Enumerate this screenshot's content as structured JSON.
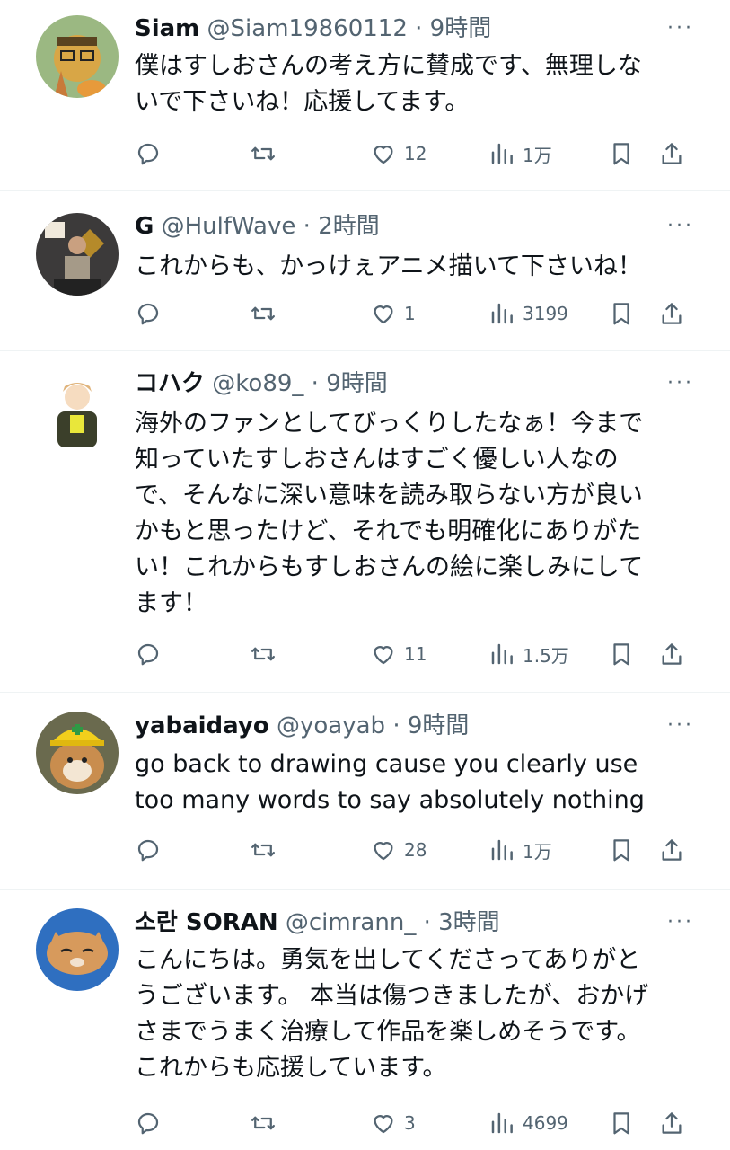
{
  "replies": [
    {
      "name": "Siam",
      "handle": "@Siam19860112",
      "time": "9時間",
      "more": "···",
      "lines": [
        "僕はすしおさんの考え方に賛成です、無理しな",
        "いで下さいね！応援してます。"
      ],
      "likes": "12",
      "views": "1万"
    },
    {
      "name": "G",
      "handle": "@HulfWave",
      "time": "2時間",
      "more": "···",
      "lines": [
        "これからも、かっけぇアニメ描いて下さいね！"
      ],
      "likes": "1",
      "views": "3199"
    },
    {
      "name": "コハク",
      "handle": "@ko89_",
      "time": "9時間",
      "more": "···",
      "lines": [
        "海外のファンとしてびっくりしたなぁ！今まで",
        "知っていたすしおさんはすごく優しい人なの",
        "で、そんなに深い意味を読み取らない方が良い",
        "かもと思ったけど、それでも明確化にありがた",
        "い！これからもすしおさんの絵に楽しみにして",
        "ます！"
      ],
      "likes": "11",
      "views": "1.5万"
    },
    {
      "name": "yabaidayo",
      "handle": "@yoayab",
      "time": "9時間",
      "more": "···",
      "lines": [
        "go back to drawing cause you clearly use",
        "too many words to say absolutely nothing"
      ],
      "likes": "28",
      "views": "1万"
    },
    {
      "name": "소란 SORAN",
      "handle": "@cimrann_",
      "time": "3時間",
      "more": "···",
      "lines": [
        "こんにちは。勇気を出してくださってありがと",
        "うございます。 本当は傷つきましたが、おかげ",
        "さまでうまく治療して作品を楽しめそうです。",
        "これからも応援しています。"
      ],
      "likes": "3",
      "views": "4699"
    }
  ],
  "icons": {
    "reply": "reply-icon",
    "repost": "repost-icon",
    "like": "heart-icon",
    "views": "views-icon",
    "bookmark": "bookmark-icon",
    "share": "share-icon"
  },
  "colors": {
    "text": "#0f1419",
    "secondary": "#536471",
    "divider": "#eff3f4"
  }
}
